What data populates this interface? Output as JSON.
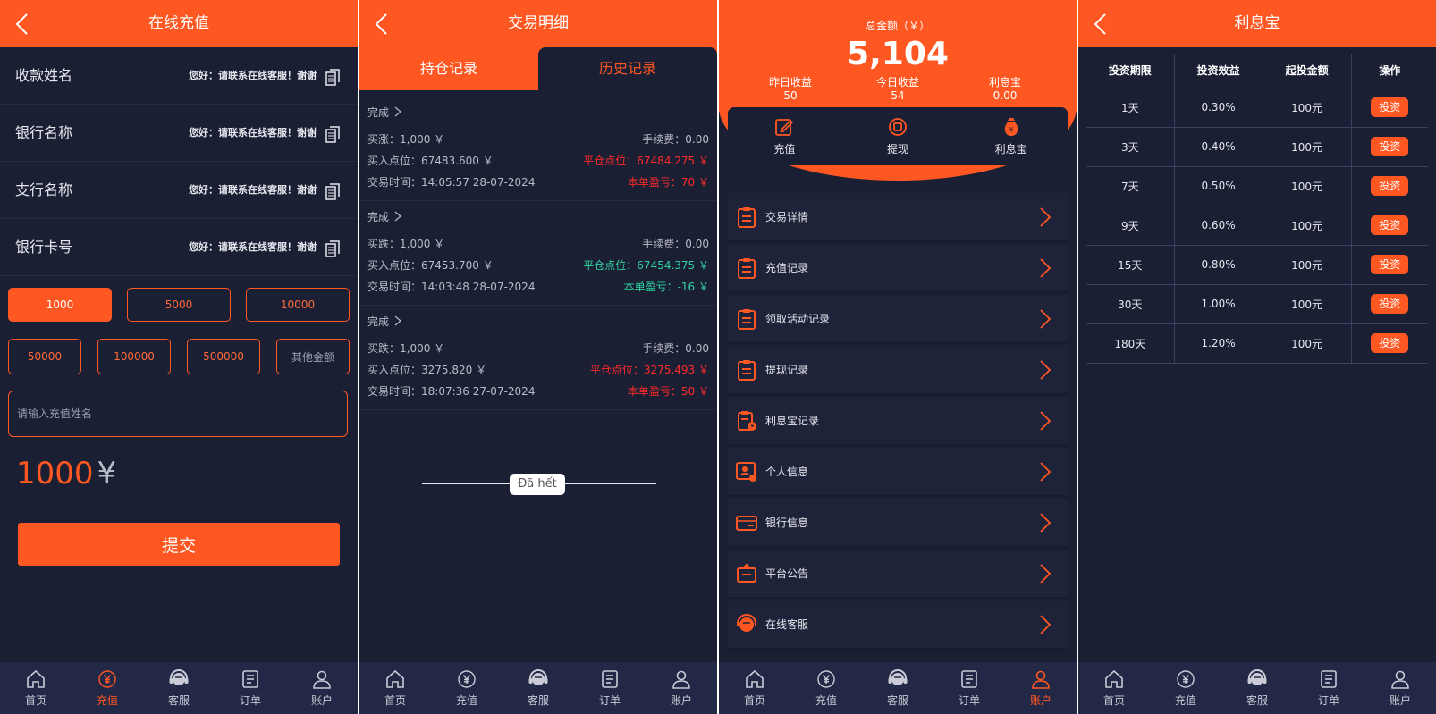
{
  "recharge": {
    "title": "在线充值",
    "rows": [
      {
        "label": "收款姓名",
        "value": "您好：请联系在线客服！谢谢"
      },
      {
        "label": "银行名称",
        "value": "您好：请联系在线客服！谢谢"
      },
      {
        "label": "支行名称",
        "value": "您好：请联系在线客服！谢谢"
      },
      {
        "label": "银行卡号",
        "value": "您好：请联系在线客服！谢谢"
      }
    ],
    "amounts_row1": [
      "1000",
      "5000",
      "10000"
    ],
    "amounts_row2": [
      "50000",
      "100000",
      "500000",
      "其他金额"
    ],
    "name_placeholder": "请输入充值姓名",
    "selected_amount": "1000",
    "currency": "¥",
    "submit_label": "提交"
  },
  "trades": {
    "title": "交易明细",
    "tab_positions": "持仓记录",
    "tab_history": "历史记录",
    "records": [
      {
        "status": "完成",
        "buy": "买涨：1,000 ￥",
        "fee": "手续费：0.00",
        "buy_point": "买入点位：67483.600 ￥",
        "close_point": "平仓点位：67484.275 ￥",
        "time": "交易时间：14:05:57 28-07-2024",
        "pnl": "本单盈亏：70 ￥",
        "color": "#ff2a2a"
      },
      {
        "status": "完成",
        "buy": "买跌：1,000 ￥",
        "fee": "手续费：0.00",
        "buy_point": "买入点位：67453.700 ￥",
        "close_point": "平仓点位：67454.375 ￥",
        "time": "交易时间：14:03:48 28-07-2024",
        "pnl": "本单盈亏：-16 ￥",
        "color": "#2ed2a0"
      },
      {
        "status": "完成",
        "buy": "买跌：1,000 ￥",
        "fee": "手续费：0.00",
        "buy_point": "买入点位：3275.820 ￥",
        "close_point": "平仓点位：3275.493 ￥",
        "time": "交易时间：18:07:36 27-07-2024",
        "pnl": "本单盈亏：50 ￥",
        "color": "#ff2a2a"
      }
    ],
    "end_text": "Đã hết"
  },
  "account": {
    "total_label": "总金额（￥）",
    "total_value": "5,104",
    "stats": [
      {
        "label": "昨日收益",
        "value": "50"
      },
      {
        "label": "今日收益",
        "value": "54"
      },
      {
        "label": "利息宝",
        "value": "0.00"
      }
    ],
    "actions": [
      "充值",
      "提现",
      "利息宝"
    ],
    "menu": [
      "交易详情",
      "充值记录",
      "领取活动记录",
      "提现记录",
      "利息宝记录",
      "个人信息",
      "银行信息",
      "平台公告",
      "在线客服"
    ]
  },
  "interest": {
    "title": "利息宝",
    "headers": [
      "投资期限",
      "投资效益",
      "起投金额",
      "操作"
    ],
    "rows": [
      {
        "term": "1天",
        "rate": "0.30%",
        "min": "100元",
        "action": "投资"
      },
      {
        "term": "3天",
        "rate": "0.40%",
        "min": "100元",
        "action": "投资"
      },
      {
        "term": "7天",
        "rate": "0.50%",
        "min": "100元",
        "action": "投资"
      },
      {
        "term": "9天",
        "rate": "0.60%",
        "min": "100元",
        "action": "投资"
      },
      {
        "term": "15天",
        "rate": "0.80%",
        "min": "100元",
        "action": "投资"
      },
      {
        "term": "30天",
        "rate": "1.00%",
        "min": "100元",
        "action": "投资"
      },
      {
        "term": "180天",
        "rate": "1.20%",
        "min": "100元",
        "action": "投资"
      }
    ]
  },
  "tabbar": {
    "items": [
      "首页",
      "充值",
      "客服",
      "订单",
      "账户"
    ],
    "icons": [
      "home-icon",
      "yuan-coin-icon",
      "headset-icon",
      "order-icon",
      "user-icon"
    ]
  },
  "colors": {
    "accent": "#ff5722",
    "background": "#1b1f33",
    "tabbar": "#232846",
    "loss": "#ff2a2a",
    "gain": "#2ed2a0"
  }
}
